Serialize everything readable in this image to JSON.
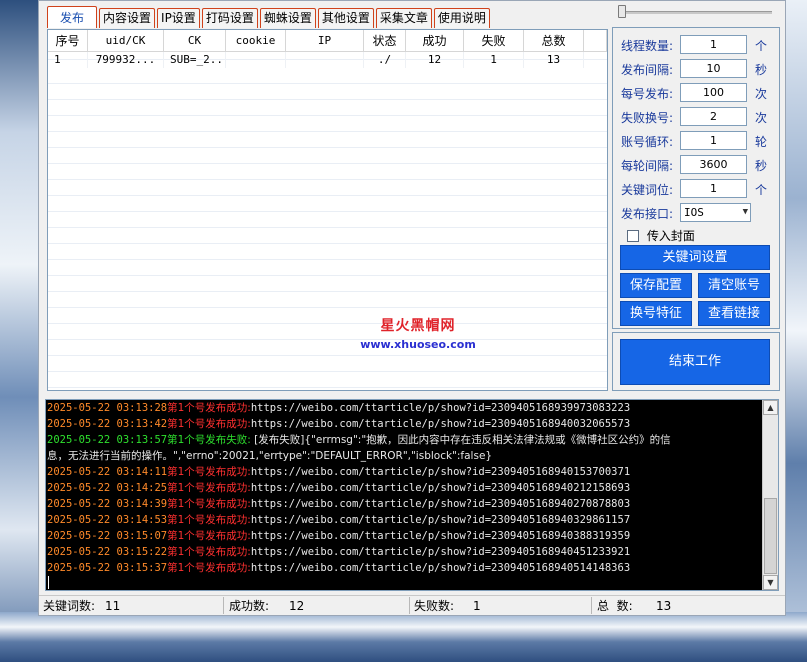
{
  "tabs": [
    "发布",
    "内容设置",
    "IP设置",
    "打码设置",
    "蜘蛛设置",
    "其他设置",
    "采集文章",
    "使用说明"
  ],
  "table": {
    "columns": [
      "序号",
      "uid/CK",
      "CK",
      "cookie",
      "IP",
      "状态",
      "成功",
      "失败",
      "总数"
    ],
    "rows": [
      [
        "1",
        "799932...",
        "SUB=_2...",
        "",
        "",
        "./",
        "12",
        "1",
        "13"
      ]
    ]
  },
  "watermark": {
    "title": "星火黑帽网",
    "url": "www.xhuoseo.com"
  },
  "settings": [
    {
      "label": "线程数量:",
      "value": "1",
      "unit": "个"
    },
    {
      "label": "发布间隔:",
      "value": "10",
      "unit": "秒"
    },
    {
      "label": "每号发布:",
      "value": "100",
      "unit": "次"
    },
    {
      "label": "失败换号:",
      "value": "2",
      "unit": "次"
    },
    {
      "label": "账号循环:",
      "value": "1",
      "unit": "轮"
    },
    {
      "label": "每轮间隔:",
      "value": "3600",
      "unit": "秒"
    },
    {
      "label": "关键词位:",
      "value": "1",
      "unit": "个"
    }
  ],
  "api": {
    "label": "发布接口:",
    "value": "IOS"
  },
  "cover": {
    "label": "传入封面",
    "checked": false
  },
  "buttons": {
    "keyword_settings": "关键词设置",
    "save_config": "保存配置",
    "clear_accounts": "清空账号",
    "switch_feature": "换号特征",
    "view_links": "查看链接",
    "stop_work": "结束工作"
  },
  "log": [
    {
      "ts": "2025-05-22 03:13:28",
      "who": "第1个号",
      "status": "发布成功:",
      "msg": "https://weibo.com/ttarticle/p/show?id=2309405168939973083223",
      "ok": true
    },
    {
      "ts": "2025-05-22 03:13:42",
      "who": "第1个号",
      "status": "发布成功:",
      "msg": "https://weibo.com/ttarticle/p/show?id=2309405168940032065573",
      "ok": true
    },
    {
      "ts": "2025-05-22 03:13:57",
      "who": "第1个号",
      "status": "发布失败:",
      "msg": " [发布失败]{\"errmsg\":\"抱歉，因此内容中存在违反相关法律法规或《微博社区公约》的信",
      "ok": false
    },
    {
      "ts": "",
      "who": "",
      "status": "",
      "msg": "息，无法进行当前的操作。\",\"errno\":20021,\"errtype\":\"DEFAULT_ERROR\",\"isblock\":false}",
      "ok": false,
      "cont": true
    },
    {
      "ts": "2025-05-22 03:14:11",
      "who": "第1个号",
      "status": "发布成功:",
      "msg": "https://weibo.com/ttarticle/p/show?id=2309405168940153700371",
      "ok": true
    },
    {
      "ts": "2025-05-22 03:14:25",
      "who": "第1个号",
      "status": "发布成功:",
      "msg": "https://weibo.com/ttarticle/p/show?id=2309405168940212158693",
      "ok": true
    },
    {
      "ts": "2025-05-22 03:14:39",
      "who": "第1个号",
      "status": "发布成功:",
      "msg": "https://weibo.com/ttarticle/p/show?id=2309405168940270878803",
      "ok": true
    },
    {
      "ts": "2025-05-22 03:14:53",
      "who": "第1个号",
      "status": "发布成功:",
      "msg": "https://weibo.com/ttarticle/p/show?id=2309405168940329861157",
      "ok": true
    },
    {
      "ts": "2025-05-22 03:15:07",
      "who": "第1个号",
      "status": "发布成功:",
      "msg": "https://weibo.com/ttarticle/p/show?id=2309405168940388319359",
      "ok": true
    },
    {
      "ts": "2025-05-22 03:15:22",
      "who": "第1个号",
      "status": "发布成功:",
      "msg": "https://weibo.com/ttarticle/p/show?id=2309405168940451233921",
      "ok": true
    },
    {
      "ts": "2025-05-22 03:15:37",
      "who": "第1个号",
      "status": "发布成功:",
      "msg": "https://weibo.com/ttarticle/p/show?id=2309405168940514148363",
      "ok": true
    }
  ],
  "statusbar": {
    "keywords_label": "关键词数:",
    "keywords": "11",
    "success_label": "成功数:",
    "success": "12",
    "fail_label": "失败数:",
    "fail": "1",
    "total_label": "总  数:",
    "total": "13"
  },
  "colors": {
    "accent": "#1666e6",
    "tab_border": "#d0421b",
    "log_bg": "#000000",
    "log_ts": "#ff8a2a",
    "log_ok": "#ff3030",
    "log_fail": "#2ee02e"
  }
}
